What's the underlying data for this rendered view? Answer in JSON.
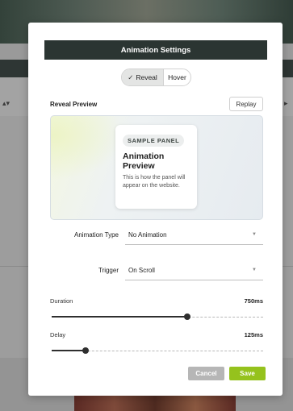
{
  "modal": {
    "title": "Animation Settings",
    "tabs": [
      {
        "label": "Reveal",
        "active": true,
        "icon": "check-icon"
      },
      {
        "label": "Hover",
        "active": false
      }
    ],
    "preview_section": {
      "title": "Reveal Preview",
      "replay_label": "Replay"
    },
    "sample_panel": {
      "badge": "SAMPLE PANEL",
      "title_line1": "Animation",
      "title_line2": "Preview",
      "description": "This is how the panel will appear on the website."
    },
    "fields": {
      "animation_type": {
        "label": "Animation Type",
        "value": "No Animation"
      },
      "trigger": {
        "label": "Trigger",
        "value": "On Scroll"
      }
    },
    "sliders": {
      "duration": {
        "label": "Duration",
        "value": "750ms",
        "fraction": 0.64
      },
      "delay": {
        "label": "Delay",
        "value": "125ms",
        "fraction": 0.16
      }
    },
    "buttons": {
      "cancel": "Cancel",
      "save": "Save"
    }
  },
  "colors": {
    "header_bg": "#2b3532",
    "save_button": "#95c21d",
    "cancel_button": "#b6b6b6"
  }
}
